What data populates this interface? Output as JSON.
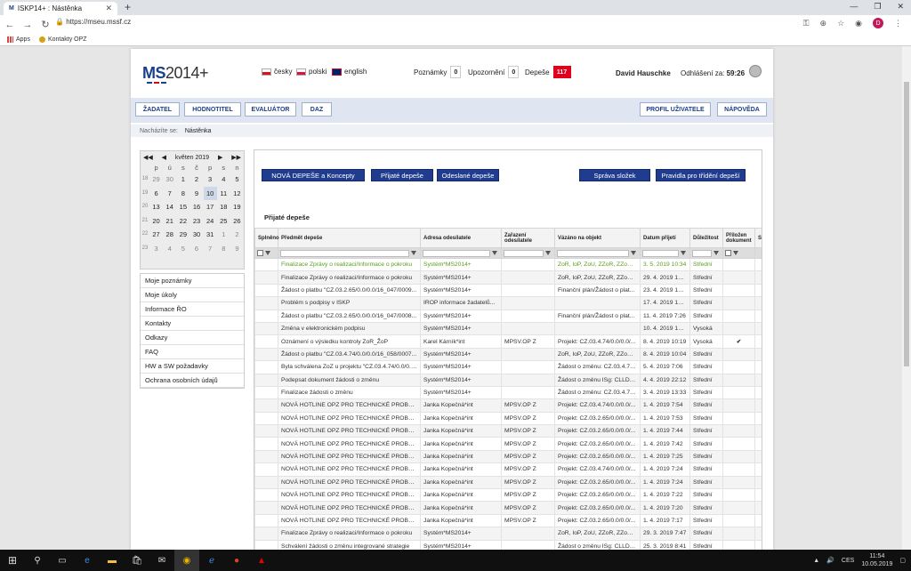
{
  "browser": {
    "tab_title": "ISKP14+ : Nástěnka",
    "url": "https://mseu.mssf.cz",
    "bookmarks": [
      "Apps",
      "Kontakty OPZ"
    ],
    "profile_initial": "D"
  },
  "header": {
    "logo_ms": "MS",
    "logo_year": "2014+",
    "languages": [
      "česky",
      "polski",
      "english"
    ],
    "counters": [
      {
        "label": "Poznámky",
        "value": "0"
      },
      {
        "label": "Upozornění",
        "value": "0"
      },
      {
        "label": "Depeše",
        "value": "117"
      }
    ],
    "user": "David Hauschke",
    "logout_label": "Odhlášení za:",
    "logout_time": "59:26"
  },
  "menu": {
    "left": [
      "ŽADATEL",
      "HODNOTITEL",
      "EVALUÁTOR",
      "DAZ"
    ],
    "right": [
      "PROFIL UŽIVATELE",
      "NÁPOVĚDA"
    ]
  },
  "breadcrumb": {
    "label": "Nacházíte se:",
    "current": "Nástěnka"
  },
  "calendar": {
    "month": "květen 2019",
    "days": [
      "p",
      "ú",
      "s",
      "č",
      "p",
      "s",
      "n"
    ],
    "weeks": [
      {
        "wk": "18",
        "d": [
          "29",
          "30",
          "1",
          "2",
          "3",
          "4",
          "5"
        ]
      },
      {
        "wk": "19",
        "d": [
          "6",
          "7",
          "8",
          "9",
          "10",
          "11",
          "12"
        ]
      },
      {
        "wk": "20",
        "d": [
          "13",
          "14",
          "15",
          "16",
          "17",
          "18",
          "19"
        ]
      },
      {
        "wk": "21",
        "d": [
          "20",
          "21",
          "22",
          "23",
          "24",
          "25",
          "26"
        ]
      },
      {
        "wk": "22",
        "d": [
          "27",
          "28",
          "29",
          "30",
          "31",
          "1",
          "2"
        ]
      },
      {
        "wk": "23",
        "d": [
          "3",
          "4",
          "5",
          "6",
          "7",
          "8",
          "9"
        ]
      }
    ]
  },
  "sidemenu": [
    "Moje poznámky",
    "Moje úkoly",
    "Informace ŘO",
    "Kontakty",
    "Odkazy",
    "FAQ",
    "HW a SW požadavky",
    "Ochrana osobních údajů"
  ],
  "actions": [
    "NOVÁ DEPEŠE a Koncepty",
    "Přijaté depeše",
    "Odeslané depeše",
    "Správa složek",
    "Pravidla pro třídění depeší"
  ],
  "section_title": "Přijaté depeše",
  "table": {
    "headers": [
      "Splněno",
      "Předmět depeše",
      "Adresa odesílatele",
      "Zařazení odesílatele",
      "Vázáno na objekt",
      "Datum přijetí",
      "Důležitost",
      "Přiložen dokument",
      "S o"
    ],
    "rows": [
      [
        "Finalizace Zprávy o realizaci/Informace o pokroku",
        "Systém*MS2014+",
        "",
        "ZoR, IoP, ZoU, ZZoR, ZZoU: u...",
        "3. 5. 2019 10:34",
        "Střední",
        ""
      ],
      [
        "Finalizace Zprávy o realizaci/Informace o pokroku",
        "Systém*MS2014+",
        "",
        "ZoR, IoP, ZoU, ZZoR, ZZoU: i...",
        "29. 4. 2019 13:20",
        "Střední",
        ""
      ],
      [
        "Žádost o platbu \"CZ.03.2.65/0.0/0.0/16_047/0009...",
        "Systém*MS2014+",
        "",
        "Finanční plán/Žádost o plat...",
        "23. 4. 2019 17:14",
        "Střední",
        ""
      ],
      [
        "Problém s podpisy v ISKP",
        "IROP informace žadatelů...",
        "",
        "",
        "17. 4. 2019 14:10",
        "Střední",
        ""
      ],
      [
        "Žádost o platbu \"CZ.03.2.65/0.0/0.0/16_047/0008...",
        "Systém*MS2014+",
        "",
        "Finanční plán/Žádost o plat...",
        "11. 4. 2019 7:26",
        "Střední",
        ""
      ],
      [
        "Změna v elektronickém podpisu",
        "Systém*MS2014+",
        "",
        "",
        "10. 4. 2019 13:32",
        "Vysoká",
        ""
      ],
      [
        "Oznámení o výsledku kontroly ZoR_ŽoP",
        "Karel Kárník*int",
        "MPSV.OP Z",
        "Projekt: CZ.03.4.74/0.0/0.0/...",
        "8. 4. 2019 10:19",
        "Vysoká",
        "✔"
      ],
      [
        "Žádost o platbu \"CZ.03.4.74/0.0/0.0/16_058/0007...",
        "Systém*MS2014+",
        "",
        "ZoR, IoP, ZoU, ZZoR, ZZoU: i...",
        "8. 4. 2019 10:04",
        "Střední",
        ""
      ],
      [
        "Byla schválena ZoZ u projektu \"CZ.03.4.74/0.0/0.0...",
        "Systém*MS2014+",
        "",
        "Žádost o změnu: CZ.03.4.74...",
        "5. 4. 2019 7:06",
        "Střední",
        ""
      ],
      [
        "Podepsat dokument žádosti o změnu",
        "Systém*MS2014+",
        "",
        "Žádost o změnu ISg: CLLD_1...",
        "4. 4. 2019 22:12",
        "Střední",
        ""
      ],
      [
        "Finalizace žádosti o změnu",
        "Systém*MS2014+",
        "",
        "Žádost o změnu: CZ.03.4.74...",
        "3. 4. 2019 13:33",
        "Střední",
        ""
      ],
      [
        "NOVÁ HOTLINE OPZ PRO TECHNICKÉ PROBLÉMY ...",
        "Janka Kopečná*int",
        "MPSV.OP Z",
        "Projekt: CZ.03.4.74/0.0/0.0/...",
        "1. 4. 2019 7:54",
        "Střední",
        ""
      ],
      [
        "NOVÁ HOTLINE OPZ PRO TECHNICKÉ PROBLÉMY ...",
        "Janka Kopečná*int",
        "MPSV.OP Z",
        "Projekt: CZ.03.2.65/0.0/0.0/...",
        "1. 4. 2019 7:53",
        "Střední",
        ""
      ],
      [
        "NOVÁ HOTLINE OPZ PRO TECHNICKÉ PROBLÉMY ...",
        "Janka Kopečná*int",
        "MPSV.OP Z",
        "Projekt: CZ.03.2.65/0.0/0.0/...",
        "1. 4. 2019 7:44",
        "Střední",
        ""
      ],
      [
        "NOVÁ HOTLINE OPZ PRO TECHNICKÉ PROBLÉMY ...",
        "Janka Kopečná*int",
        "MPSV.OP Z",
        "Projekt: CZ.03.2.65/0.0/0.0/...",
        "1. 4. 2019 7:42",
        "Střední",
        ""
      ],
      [
        "NOVÁ HOTLINE OPZ PRO TECHNICKÉ PROBLÉMY ...",
        "Janka Kopečná*int",
        "MPSV.OP Z",
        "Projekt: CZ.03.2.65/0.0/0.0/...",
        "1. 4. 2019 7:25",
        "Střední",
        ""
      ],
      [
        "NOVÁ HOTLINE OPZ PRO TECHNICKÉ PROBLÉMY ...",
        "Janka Kopečná*int",
        "MPSV.OP Z",
        "Projekt: CZ.03.4.74/0.0/0.0/...",
        "1. 4. 2019 7:24",
        "Střední",
        ""
      ],
      [
        "NOVÁ HOTLINE OPZ PRO TECHNICKÉ PROBLÉMY ...",
        "Janka Kopečná*int",
        "MPSV.OP Z",
        "Projekt: CZ.03.2.65/0.0/0.0/...",
        "1. 4. 2019 7:24",
        "Střední",
        ""
      ],
      [
        "NOVÁ HOTLINE OPZ PRO TECHNICKÉ PROBLÉMY ...",
        "Janka Kopečná*int",
        "MPSV.OP Z",
        "Projekt: CZ.03.2.65/0.0/0.0/...",
        "1. 4. 2019 7:22",
        "Střední",
        ""
      ],
      [
        "NOVÁ HOTLINE OPZ PRO TECHNICKÉ PROBLÉMY ...",
        "Janka Kopečná*int",
        "MPSV.OP Z",
        "Projekt: CZ.03.2.65/0.0/0.0/...",
        "1. 4. 2019 7:20",
        "Střední",
        ""
      ],
      [
        "NOVÁ HOTLINE OPZ PRO TECHNICKÉ PROBLÉMY ...",
        "Janka Kopečná*int",
        "MPSV.OP Z",
        "Projekt: CZ.03.2.65/0.0/0.0/...",
        "1. 4. 2019 7:17",
        "Střední",
        ""
      ],
      [
        "Finalizace Zprávy o realizaci/Informace o pokroku",
        "Systém*MS2014+",
        "",
        "ZoR, IoP, ZoU, ZZoR, ZZoU: i...",
        "29. 3. 2019 7:47",
        "Střední",
        ""
      ],
      [
        "Schválení žádosti o změnu integrované strategie",
        "Systém*MS2014+",
        "",
        "Žádost o změnu ISg: CLLD_1...",
        "25. 3. 2019 8:41",
        "Střední",
        ""
      ]
    ]
  },
  "taskbar": {
    "lang": "CES",
    "time": "11:54",
    "date": "10.05.2019"
  }
}
